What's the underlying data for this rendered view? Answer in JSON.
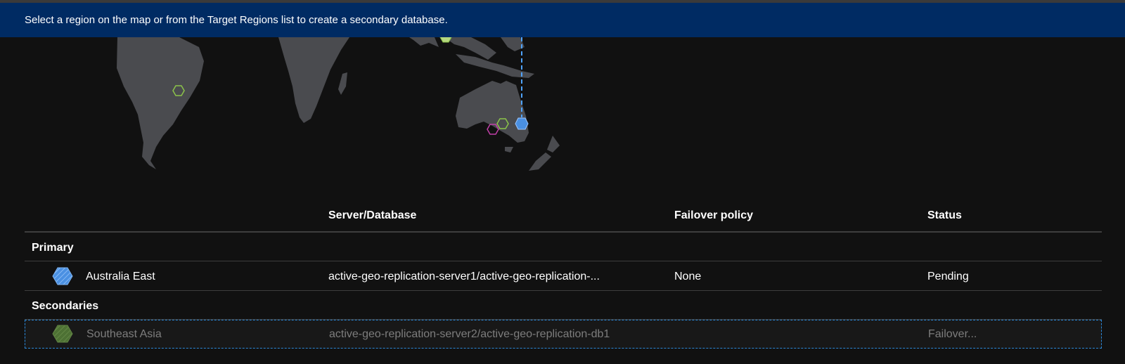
{
  "banner": {
    "text": "Select a region on the map or from the Target Regions list to create a secondary database."
  },
  "colors": {
    "banner_bg": "#002b63",
    "primary_region": "#4a90e2",
    "secondary_region": "#6fa84a",
    "other_region_green": "#8bc34a",
    "other_region_magenta": "#c13fa8",
    "replication_line": "#4fa3ff"
  },
  "table": {
    "columns": [
      "",
      "Server/Database",
      "Failover policy",
      "Status"
    ],
    "primary_group": {
      "label": "Primary",
      "row": {
        "region": "Australia East",
        "server_database": "active-geo-replication-server1/active-geo-replication-...",
        "failover_policy": "None",
        "status": "Pending"
      }
    },
    "secondaries_group": {
      "label": "Secondaries",
      "row": {
        "region": "Southeast Asia",
        "server_database": "active-geo-replication-server2/active-geo-replication-db1",
        "failover_policy": "",
        "status": "Failover..."
      }
    }
  }
}
